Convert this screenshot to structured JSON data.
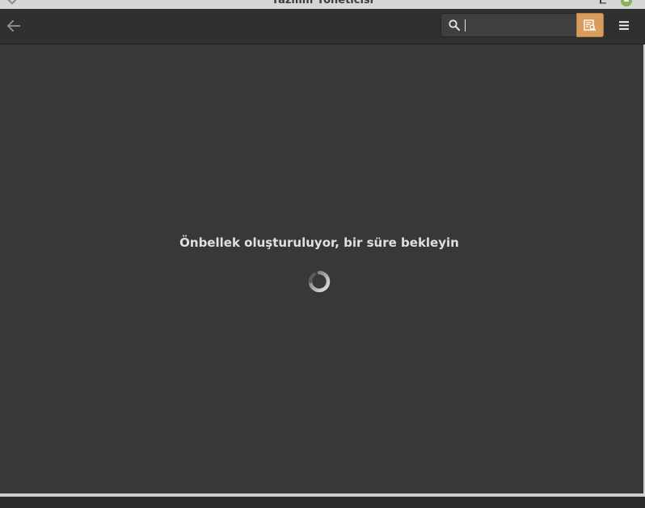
{
  "window": {
    "title": "Yazılım Yöneticisi"
  },
  "header": {
    "back_icon": "arrow-left-icon",
    "search": {
      "value": "",
      "placeholder": ""
    },
    "search_mode_icon": "search-in-text-icon",
    "menu_icon": "hamburger-menu-icon"
  },
  "main": {
    "loading_message": "Önbellek oluşturuluyor, bir süre bekleyin",
    "spinner_icon": "loading-spinner-icon"
  },
  "colors": {
    "accent": "#d89c5e",
    "background": "#383838",
    "headerbar": "#303030"
  }
}
